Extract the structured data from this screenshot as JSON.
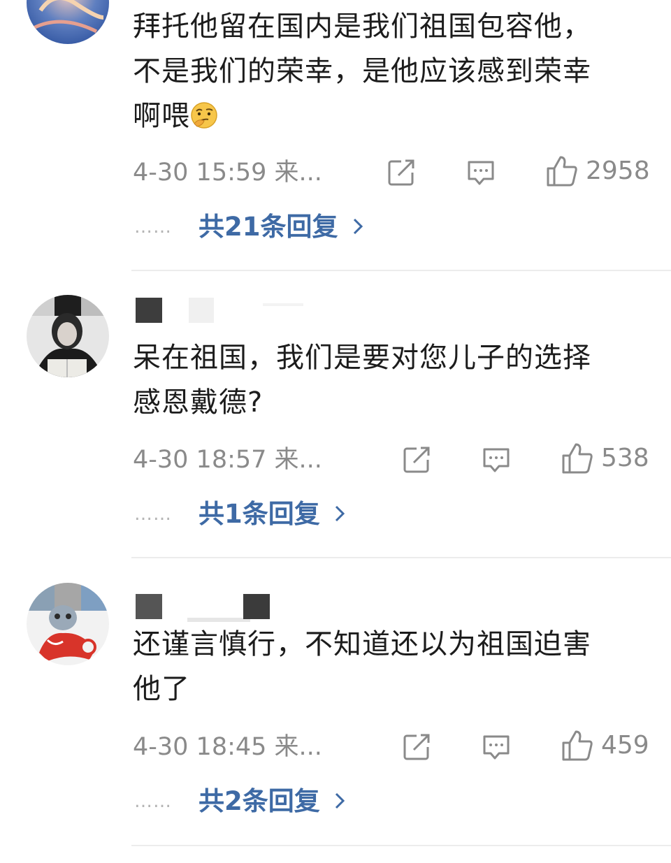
{
  "comments": [
    {
      "text_line1": "拜托他留在国内是我们祖国包容他，",
      "text_line2": "不是我们的荣幸，是他应该感到荣幸",
      "text_line3": "啊喂",
      "emoji": "thinking-face-emoji",
      "time": "4-30 15:59 来...",
      "likes": "2958",
      "replies_label": "共21条回复"
    },
    {
      "text_line1": "呆在祖国，我们是要对您儿子的选择",
      "text_line2": "感恩戴德?",
      "time": "4-30 18:57 来...",
      "likes": "538",
      "replies_label": "共1条回复"
    },
    {
      "text_line1": "还谨言慎行，不知道还以为祖国迫害",
      "text_line2": "他了",
      "time": "4-30 18:45 来...",
      "likes": "459",
      "replies_label": "共2条回复"
    }
  ],
  "dots": "……",
  "icons": {
    "share": "share-icon",
    "comment": "comment-icon",
    "like": "thumbs-up-icon",
    "chevron": "chevron-right-icon"
  },
  "colors": {
    "link": "#3e6aa5",
    "meta": "#8a8a8a",
    "divider": "#ececec"
  }
}
